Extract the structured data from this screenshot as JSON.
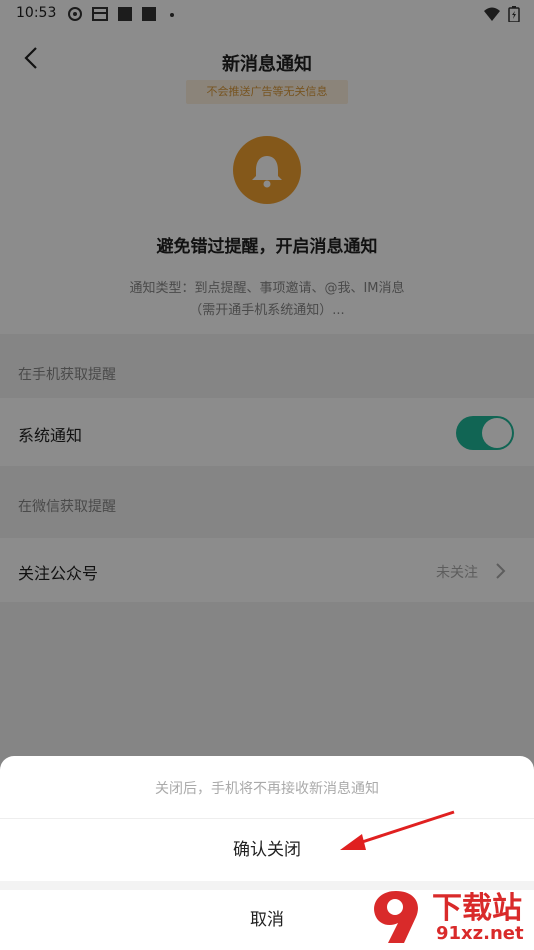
{
  "status_bar": {
    "time": "10:53"
  },
  "nav": {
    "title": "新消息通知"
  },
  "tip": "不会推送广告等无关信息",
  "hero": {
    "headline": "避免错过提醒，开启消息通知",
    "desc_line1": "通知类型：到点提醒、事项邀请、@我、IM消息",
    "desc_line2": "（需开通手机系统通知）..."
  },
  "sections": {
    "phone_label": "在手机获取提醒",
    "system_notify_label": "系统通知",
    "system_notify_on": true,
    "wechat_label": "在微信获取提醒",
    "follow_label": "关注公众号",
    "follow_value": "未关注"
  },
  "sheet": {
    "message": "关闭后，手机将不再接收新消息通知",
    "confirm": "确认关闭",
    "cancel": "取消"
  },
  "watermark": {
    "main": "下载站",
    "sub": "91xz.net"
  },
  "colors": {
    "accent": "#1fb89a",
    "bell": "#f0a030",
    "tip_text": "#d99a3c",
    "arrow": "#e02020"
  }
}
